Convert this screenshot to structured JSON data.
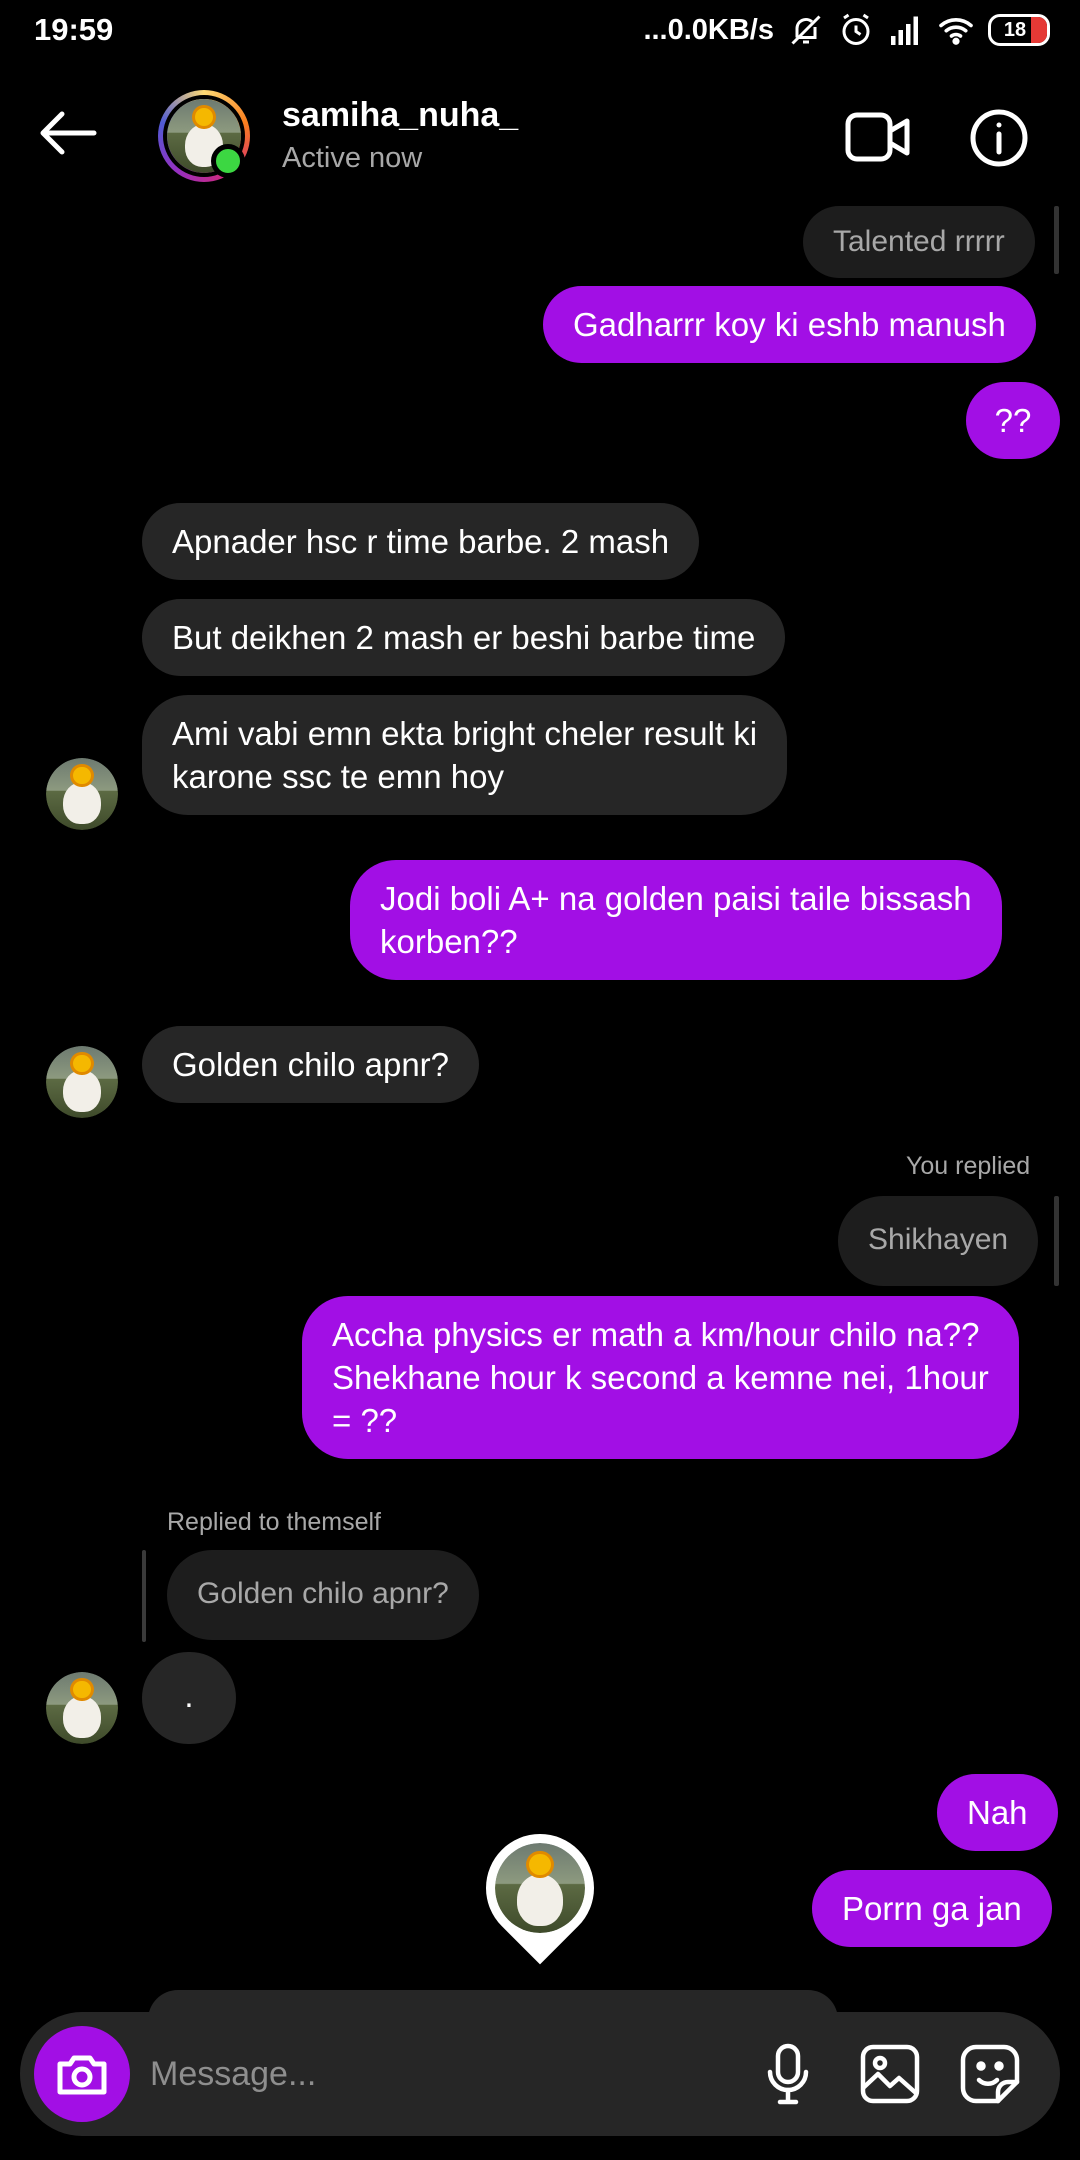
{
  "status_bar": {
    "time": "19:59",
    "net_speed": "...0.0KB/s",
    "battery_level": "18",
    "icons": [
      "mute-icon",
      "alarm-icon",
      "signal-icon",
      "wifi-icon",
      "battery-icon"
    ]
  },
  "header": {
    "username": "samiha_nuha_",
    "status": "Active now",
    "icons": [
      "back-arrow-icon",
      "video-call-icon",
      "info-icon"
    ]
  },
  "messages": {
    "m1": "Talented rrrrr",
    "m2": "Gadharrr koy ki eshb manush",
    "m3": "??",
    "m4": "Apnader hsc r time barbe. 2 mash",
    "m5": "But deikhen 2 mash er beshi barbe time",
    "m6": "Ami vabi emn ekta bright cheler result ki\nkarone ssc te emn hoy",
    "m7": "Jodi boli A+ na golden paisi taile bissash\nkorben??",
    "m8": "Golden chilo apnr?",
    "you_replied_label": "You replied",
    "m9_quoted": "Shikhayen",
    "m10": "Accha physics er math a km/hour chilo na??\nShekhane hour k second a kemne nei, 1hour\n= ??",
    "replied_themself_label": "Replied to themself",
    "m11_quoted": "Golden chilo apnr?",
    "m12": ".",
    "m13": "Nah",
    "m14": "Porrn ga jan"
  },
  "composer": {
    "placeholder": "Message...",
    "icons": [
      "camera-icon",
      "microphone-icon",
      "gallery-icon",
      "sticker-icon"
    ]
  },
  "colors": {
    "sent_bubble": "#a20fe5",
    "received_bubble": "#262626",
    "background": "#000000",
    "online": "#3cd742"
  }
}
